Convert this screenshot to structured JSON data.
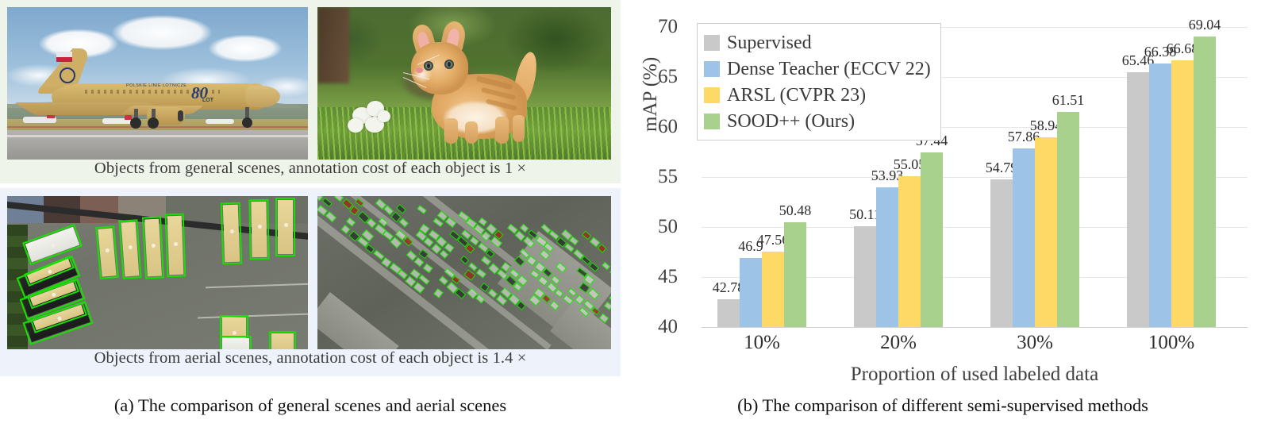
{
  "figure": {
    "subcaption_a": "(a) The comparison of general scenes and aerial scenes",
    "subcaption_b": "(b) The comparison of different semi-supervised methods"
  },
  "panel_a": {
    "general": {
      "caption": "Objects from general scenes, annotation cost of each object is 1 ×",
      "background_color": "#eef4e9",
      "images": [
        {
          "name": "airplane-photo",
          "subject": "LOT Polish Airlines Boeing 737 on tarmac"
        },
        {
          "name": "kitten-photo",
          "subject": "orange tabby kitten in grass near white flowers"
        }
      ]
    },
    "aerial": {
      "caption": "Objects from aerial scenes, annotation cost of each object is 1.4 ×",
      "background_color": "#edf2fb",
      "annotation_box_color": "#16e000",
      "images": [
        {
          "name": "aerial-buses-photo",
          "subject": "aerial view of school buses with oriented green boxes"
        },
        {
          "name": "aerial-parking-photo",
          "subject": "aerial view of dense parking lot with oriented green boxes"
        }
      ]
    }
  },
  "chart_data": {
    "type": "bar",
    "title": "",
    "xlabel": "Proportion of used labeled data",
    "ylabel": "mAP (%)",
    "categories": [
      "10%",
      "20%",
      "30%",
      "100%"
    ],
    "ylim": [
      40,
      70
    ],
    "yticks": [
      40,
      45,
      50,
      55,
      60,
      65,
      70
    ],
    "grid": true,
    "legend_position": "top-left",
    "series": [
      {
        "name": "Supervised",
        "color": "#c9c9c9",
        "values": [
          42.78,
          50.11,
          54.79,
          65.46
        ]
      },
      {
        "name": "Dense Teacher (ECCV 22)",
        "color": "#9dc3e6",
        "values": [
          46.9,
          53.93,
          57.86,
          66.38
        ]
      },
      {
        "name": "ARSL (CVPR 23)",
        "color": "#ffd966",
        "values": [
          47.56,
          55.05,
          58.94,
          66.68
        ]
      },
      {
        "name": "SOOD++ (Ours)",
        "color": "#a9d18e",
        "values": [
          50.48,
          57.44,
          61.51,
          69.04
        ]
      }
    ],
    "value_labels": [
      [
        "42.78",
        "46.9",
        "47.56",
        "50.48"
      ],
      [
        "50.11",
        "53.93",
        "55.05",
        "57.44"
      ],
      [
        "54.79",
        "57.86",
        "58.94",
        "61.51"
      ],
      [
        "65.46",
        "66.38",
        "66.68",
        "69.04"
      ]
    ]
  }
}
